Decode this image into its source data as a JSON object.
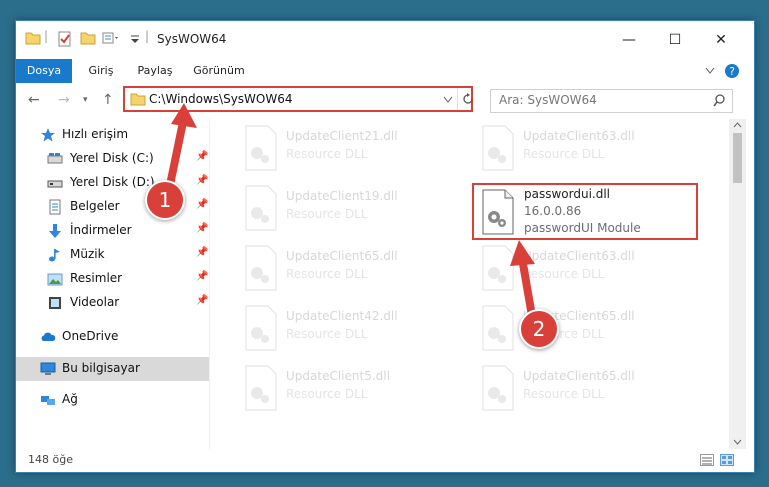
{
  "window": {
    "title": "SysWOW64",
    "title_separator": "|",
    "controls": {
      "minimize": "—",
      "maximize": "☐",
      "close": "✕"
    }
  },
  "ribbon": {
    "tabs": [
      "Dosya",
      "Giriş",
      "Paylaş",
      "Görünüm"
    ],
    "expand_icon": "chevron-down-icon",
    "help_icon": "help-icon"
  },
  "address": {
    "path": "C:\\Windows\\SysWOW64",
    "search_placeholder": "Ara: SysWOW64"
  },
  "sidebar": {
    "items": [
      {
        "label": "Hızlı erişim",
        "icon": "star-icon",
        "pinned": false
      },
      {
        "label": "Yerel Disk (C:)",
        "icon": "drive-icon",
        "pinned": true
      },
      {
        "label": "Yerel Disk (D:)",
        "icon": "drive-icon",
        "pinned": true
      },
      {
        "label": "Belgeler",
        "icon": "documents-icon",
        "pinned": true
      },
      {
        "label": "İndirmeler",
        "icon": "download-icon",
        "pinned": true
      },
      {
        "label": "Müzik",
        "icon": "music-icon",
        "pinned": true
      },
      {
        "label": "Resimler",
        "icon": "pictures-icon",
        "pinned": true
      },
      {
        "label": "Videolar",
        "icon": "video-icon",
        "pinned": true
      },
      {
        "label": "OneDrive",
        "icon": "cloud-icon",
        "pinned": false
      },
      {
        "label": "Bu bilgisayar",
        "icon": "computer-icon",
        "pinned": false,
        "selected": true
      },
      {
        "label": "Ağ",
        "icon": "network-icon",
        "pinned": false
      }
    ]
  },
  "files": [
    {
      "name": "UpdateClient21.dll",
      "sub": "Resource DLL"
    },
    {
      "name": "UpdateClient63.dll",
      "sub": "Resource DLL"
    },
    {
      "name": "UpdateClient19.dll",
      "sub": "Resource DLL"
    },
    {
      "name": "passwordui.dll",
      "version": "16.0.0.86",
      "sub": "passwordUI Module",
      "highlighted": true
    },
    {
      "name": "UpdateClient65.dll",
      "sub": "Resource DLL"
    },
    {
      "name": "UpdateClient63.dll",
      "sub": "Resource DLL"
    },
    {
      "name": "UpdateClient42.dll",
      "sub": "Resource DLL"
    },
    {
      "name": "UpdateClient65.dll",
      "sub": "Resource DLL"
    },
    {
      "name": "UpdateClient5.dll",
      "sub": "Resource DLL"
    },
    {
      "name": "UpdateClient65.dll",
      "sub": "Resource DLL"
    }
  ],
  "status": {
    "item_count": "148 öğe"
  },
  "callouts": {
    "one": "1",
    "two": "2"
  },
  "colors": {
    "accent": "#1979ca",
    "highlight": "#d9403a",
    "selected": "#d9d9d9"
  }
}
